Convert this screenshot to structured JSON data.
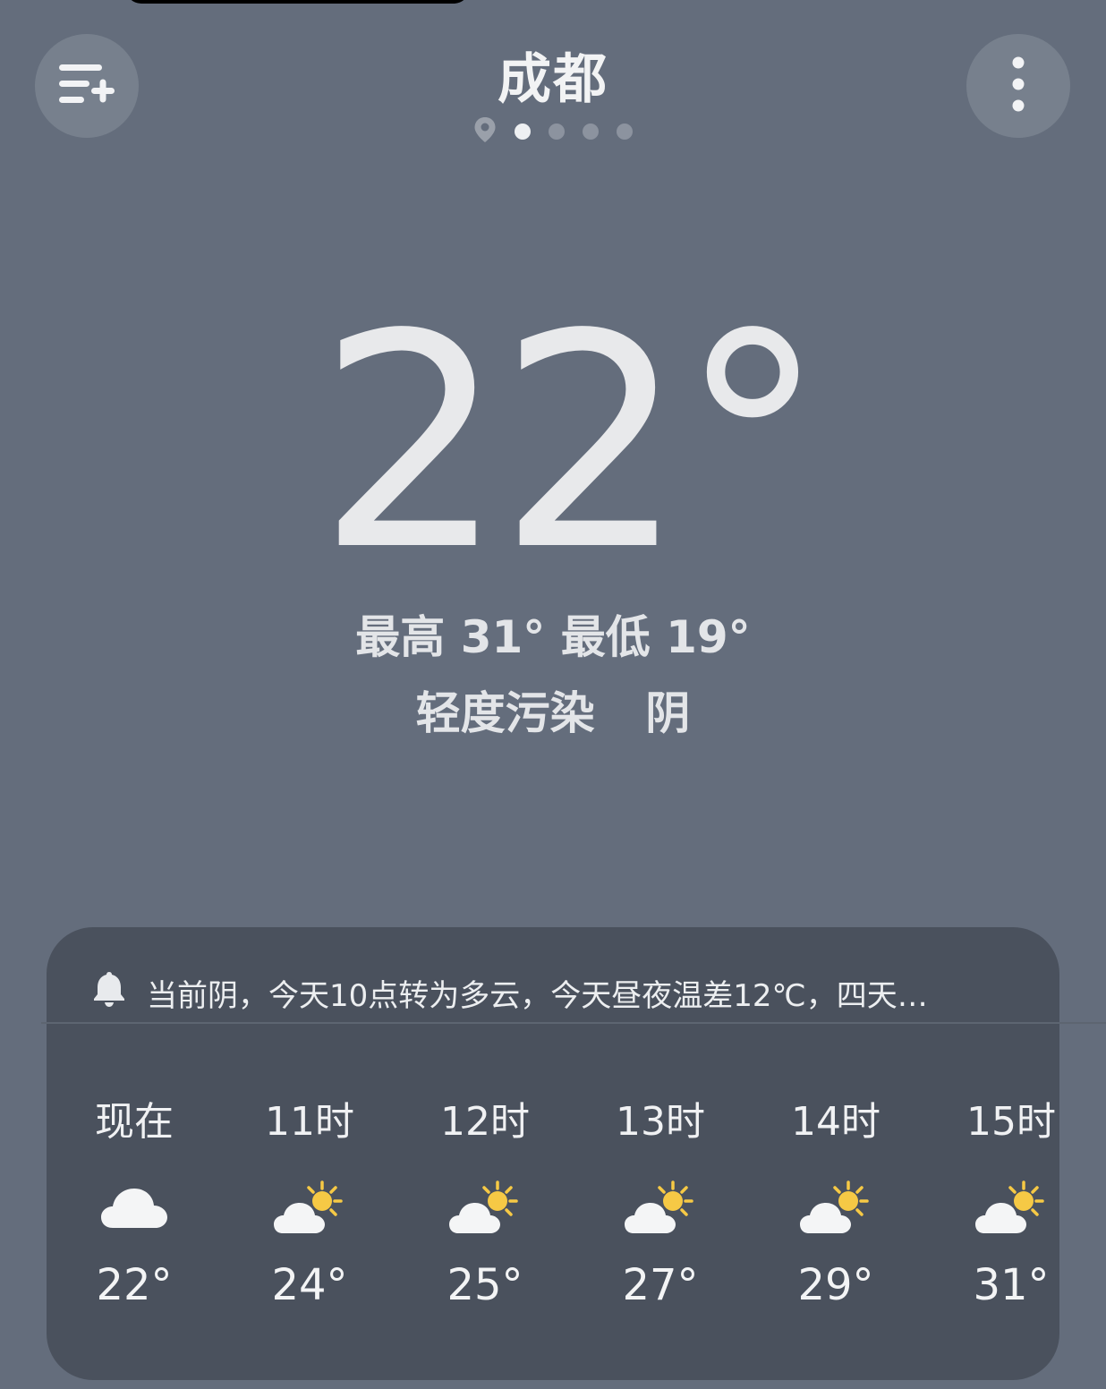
{
  "header": {
    "city": "成都",
    "pager": {
      "total_pages": 4,
      "active_index": 0
    }
  },
  "current": {
    "temperature": "22",
    "degree_symbol": "°",
    "high_low": "最高 31° 最低 19°",
    "air_quality": "轻度污染",
    "condition": "阴"
  },
  "card": {
    "notice": "当前阴，今天10点转为多云，今天昼夜温差12℃，四天…",
    "hours": [
      {
        "label": "现在",
        "icon": "cloud-icon",
        "temp": "22°"
      },
      {
        "label": "11时",
        "icon": "partly-sunny-icon",
        "temp": "24°"
      },
      {
        "label": "12时",
        "icon": "partly-sunny-icon",
        "temp": "25°"
      },
      {
        "label": "13时",
        "icon": "partly-sunny-icon",
        "temp": "27°"
      },
      {
        "label": "14时",
        "icon": "partly-sunny-icon",
        "temp": "29°"
      },
      {
        "label": "15时",
        "icon": "partly-sunny-icon",
        "temp": "31°"
      }
    ]
  },
  "colors": {
    "background": "#646d7c",
    "card": "#4a515d",
    "sun": "#f6c945",
    "text": "#e9eaec"
  }
}
